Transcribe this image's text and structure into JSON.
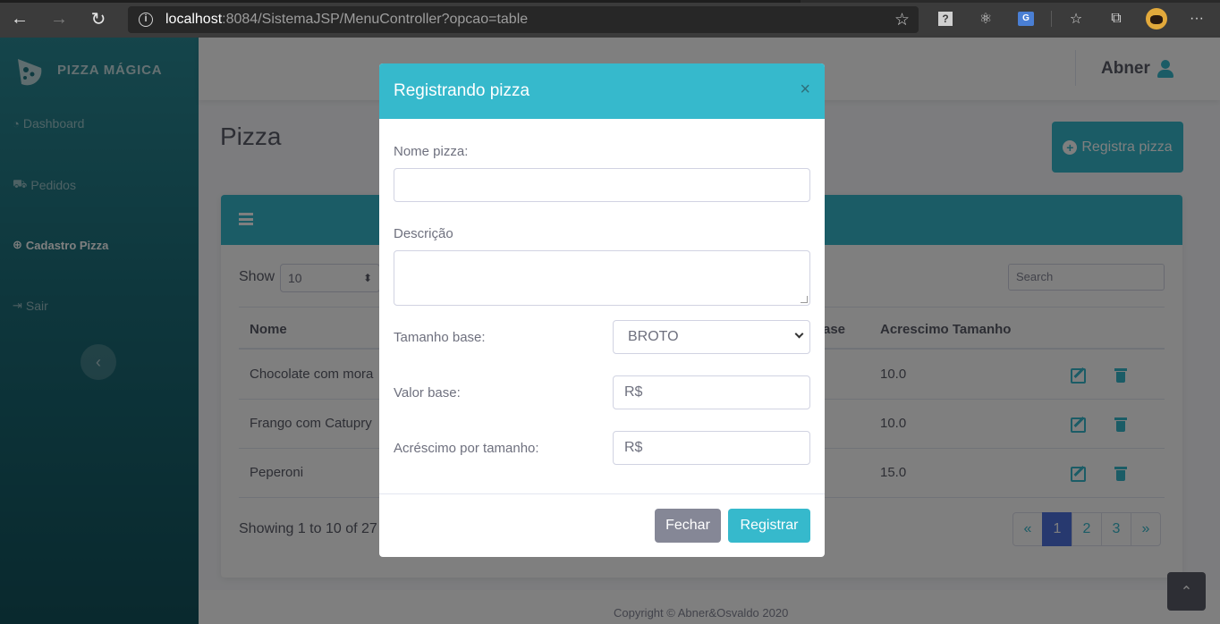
{
  "browser": {
    "url_host": "localhost",
    "url_rest": ":8084/SistemaJSP/MenuController?opcao=table"
  },
  "brand": {
    "name": "PIZZA MÁGICA"
  },
  "sidebar": {
    "items": [
      {
        "label": "Dashboard",
        "icon": "tachometer-icon"
      },
      {
        "label": "Pedidos",
        "icon": "truck-icon"
      },
      {
        "label": "Cadastro Pizza",
        "icon": "plus-circle-icon",
        "active": true
      },
      {
        "label": "Sair",
        "icon": "sign-out-icon"
      }
    ]
  },
  "topbar": {
    "user_name": "Abner"
  },
  "page": {
    "title": "Pizza",
    "register_button": "Registra pizza"
  },
  "table": {
    "show_label": "Show",
    "page_size": "10",
    "search_placeholder": "Search",
    "headers": [
      "Nome",
      "ase",
      "Acrescimo Tamanho"
    ],
    "rows": [
      {
        "nome": "Chocolate com mora",
        "acrescimo": "10.0"
      },
      {
        "nome": "Frango com Catupry",
        "acrescimo": "10.0"
      },
      {
        "nome": "Peperoni",
        "acrescimo": "15.0"
      }
    ],
    "showing": "Showing 1 to 10 of 27",
    "pagination": [
      "«",
      "1",
      "2",
      "3",
      "»"
    ],
    "active_page": "1"
  },
  "footer": {
    "copyright": "Copyright © Abner&Osvaldo 2020"
  },
  "modal": {
    "title": "Registrando pizza",
    "close": "×",
    "nome_label": "Nome pizza:",
    "nome_value": "",
    "descricao_label": "Descrição",
    "descricao_value": "",
    "tamanho_label": "Tamanho base:",
    "tamanho_value": "BROTO",
    "valor_label": "Valor base:",
    "valor_placeholder": "R$",
    "acrescimo_label": "Acréscimo por tamanho:",
    "acrescimo_placeholder": "R$",
    "fechar_button": "Fechar",
    "registrar_button": "Registrar"
  },
  "colors": {
    "accent": "#36b9cc",
    "sidebar_top": "#2a8a96",
    "sidebar_bottom": "#13525c",
    "primary_page": "#4e73df",
    "secondary_button": "#858796"
  }
}
